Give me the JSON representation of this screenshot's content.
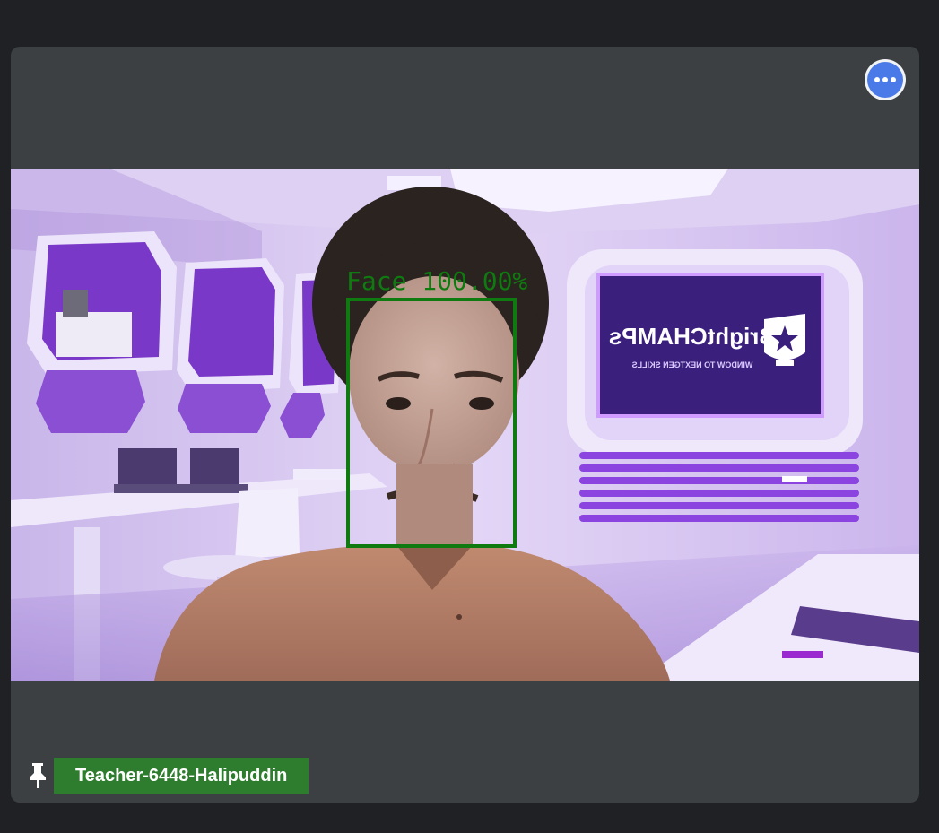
{
  "participant": {
    "name": "Teacher-6448-Halipuddin",
    "pinned": true,
    "pin_icon": "pin-icon",
    "badge_color": "#2e7d2e"
  },
  "more_options": {
    "icon": "more-horizontal-icon",
    "color": "#4a7ae8"
  },
  "video": {
    "background_brand": "BrightCHAMPs",
    "background_tagline": "WINDOW TO NEXTGEN SKILLS",
    "detection": {
      "label": "Face 100.00%",
      "color": "#0f7a0f"
    }
  }
}
